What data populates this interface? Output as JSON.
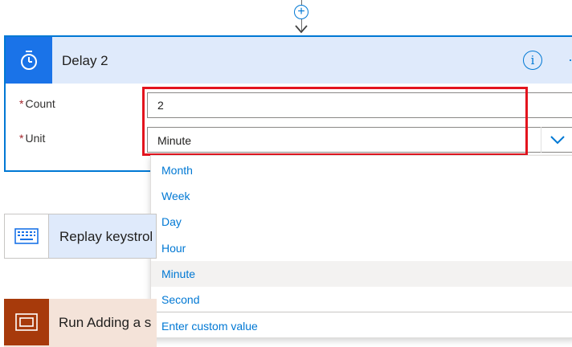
{
  "connector": {
    "add_symbol": "+"
  },
  "delay_card": {
    "title": "Delay 2",
    "info_symbol": "i",
    "more_symbol": "·",
    "count": {
      "required_mark": "*",
      "label": "Count",
      "value": "2"
    },
    "unit": {
      "required_mark": "*",
      "label": "Unit",
      "value": "Minute"
    }
  },
  "unit_dropdown": {
    "options": [
      "Month",
      "Week",
      "Day",
      "Hour",
      "Minute",
      "Second"
    ],
    "selected": "Minute",
    "custom_value_label": "Enter custom value"
  },
  "steps": [
    {
      "title": "Replay keystrol",
      "icon": "keyboard-icon"
    },
    {
      "title": "Run Adding a s",
      "icon": "window-icon"
    }
  ],
  "colors": {
    "accent": "#0078d4",
    "header_bg": "#dfeafb",
    "highlight": "#e3141e",
    "run_icon_bg": "#a73a0b"
  }
}
